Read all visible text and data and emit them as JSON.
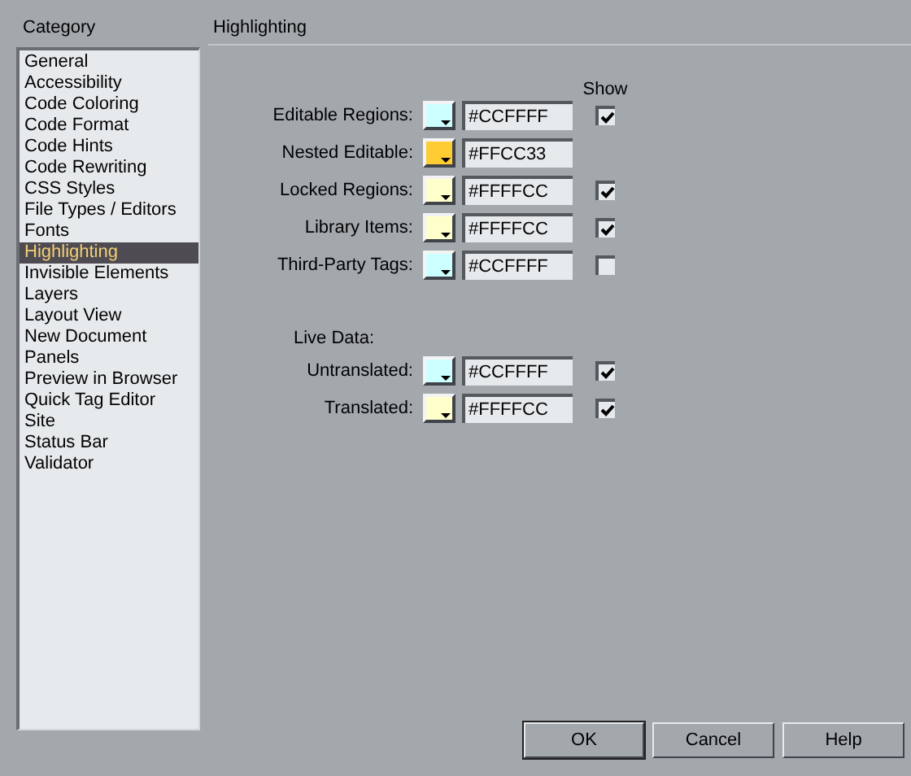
{
  "category": {
    "title": "Category",
    "items": [
      {
        "label": "General",
        "selected": false
      },
      {
        "label": "Accessibility",
        "selected": false
      },
      {
        "label": "Code Coloring",
        "selected": false
      },
      {
        "label": "Code Format",
        "selected": false
      },
      {
        "label": "Code Hints",
        "selected": false
      },
      {
        "label": "Code Rewriting",
        "selected": false
      },
      {
        "label": "CSS Styles",
        "selected": false
      },
      {
        "label": "File Types / Editors",
        "selected": false
      },
      {
        "label": "Fonts",
        "selected": false
      },
      {
        "label": "Highlighting",
        "selected": true
      },
      {
        "label": "Invisible Elements",
        "selected": false
      },
      {
        "label": "Layers",
        "selected": false
      },
      {
        "label": "Layout View",
        "selected": false
      },
      {
        "label": "New Document",
        "selected": false
      },
      {
        "label": "Panels",
        "selected": false
      },
      {
        "label": "Preview in Browser",
        "selected": false
      },
      {
        "label": "Quick Tag Editor",
        "selected": false
      },
      {
        "label": "Site",
        "selected": false
      },
      {
        "label": "Status Bar",
        "selected": false
      },
      {
        "label": "Validator",
        "selected": false
      }
    ]
  },
  "panel": {
    "title": "Highlighting",
    "show_header": "Show",
    "rows": [
      {
        "label": "Editable Regions:",
        "color": "#ccffff",
        "value": "#CCFFFF",
        "checked": true
      },
      {
        "label": "Nested Editable:",
        "color": "#ffcc33",
        "value": "#FFCC33"
      },
      {
        "label": "Locked Regions:",
        "color": "#ffffcc",
        "value": "#FFFFCC",
        "checked": true
      },
      {
        "label": "Library Items:",
        "color": "#ffffcc",
        "value": "#FFFFCC",
        "checked": true
      },
      {
        "label": "Third-Party Tags:",
        "color": "#ccffff",
        "value": "#CCFFFF",
        "checked": false
      }
    ],
    "live_data_label": "Live Data:",
    "live_rows": [
      {
        "label": "Untranslated:",
        "color": "#ccffff",
        "value": "#CCFFFF",
        "checked": true
      },
      {
        "label": "Translated:",
        "color": "#ffffcc",
        "value": "#FFFFCC",
        "checked": true
      }
    ]
  },
  "buttons": [
    {
      "label": "OK",
      "default": true
    },
    {
      "label": "Cancel",
      "default": false
    },
    {
      "label": "Help",
      "default": false
    }
  ]
}
